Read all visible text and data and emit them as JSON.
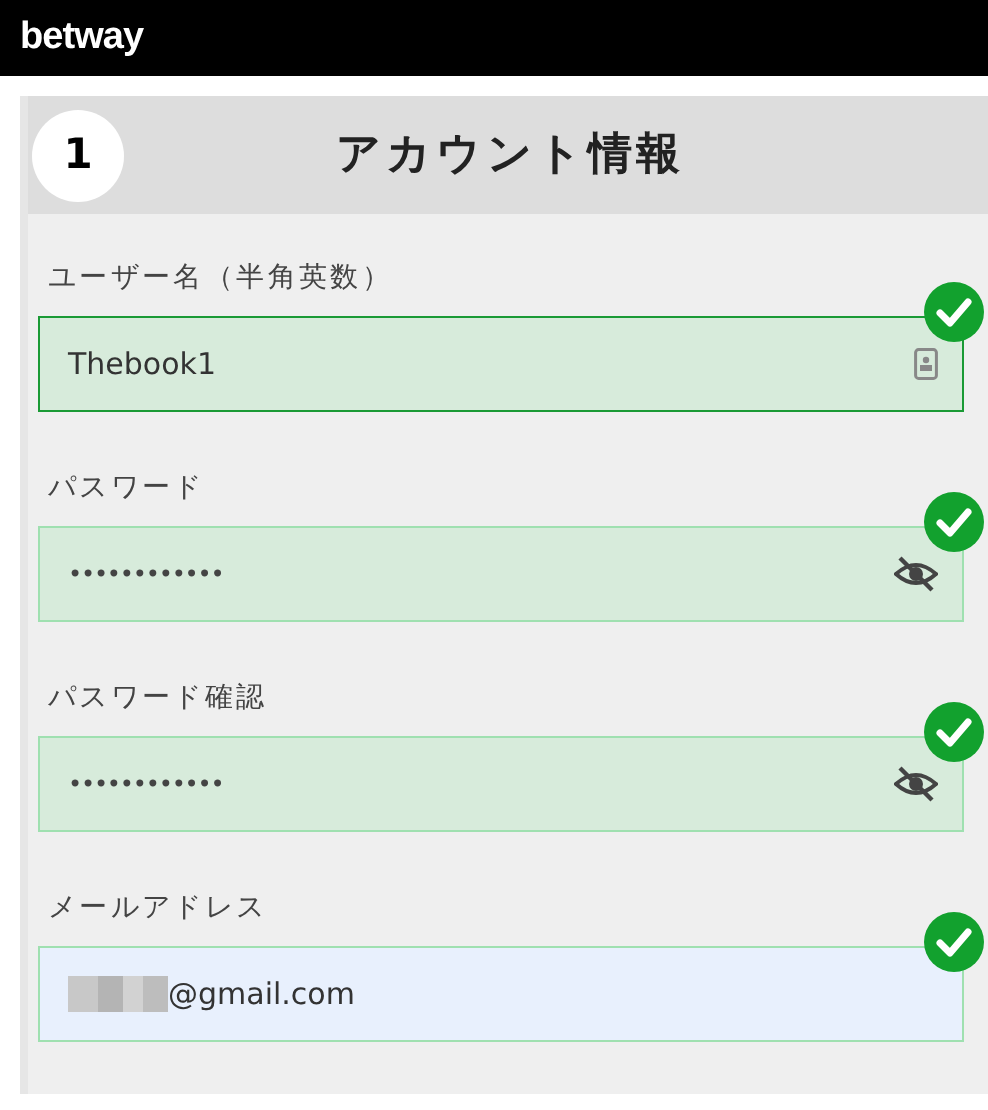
{
  "header": {
    "logo": "betway"
  },
  "section": {
    "step": "1",
    "title": "アカウント情報"
  },
  "fields": [
    {
      "kind": "text",
      "label": "ユーザー名（半角英数）",
      "value": "Thebook1",
      "focused": true,
      "valid": true
    },
    {
      "kind": "password",
      "label": "パスワード",
      "value": "••••••••••••",
      "focused": false,
      "valid": true
    },
    {
      "kind": "password",
      "label": "パスワード確認",
      "value": "••••••••••••",
      "focused": false,
      "valid": true
    },
    {
      "kind": "email",
      "label": "メールアドレス",
      "value": "@gmail.com",
      "redacted": true,
      "focused": false,
      "valid": true
    }
  ]
}
